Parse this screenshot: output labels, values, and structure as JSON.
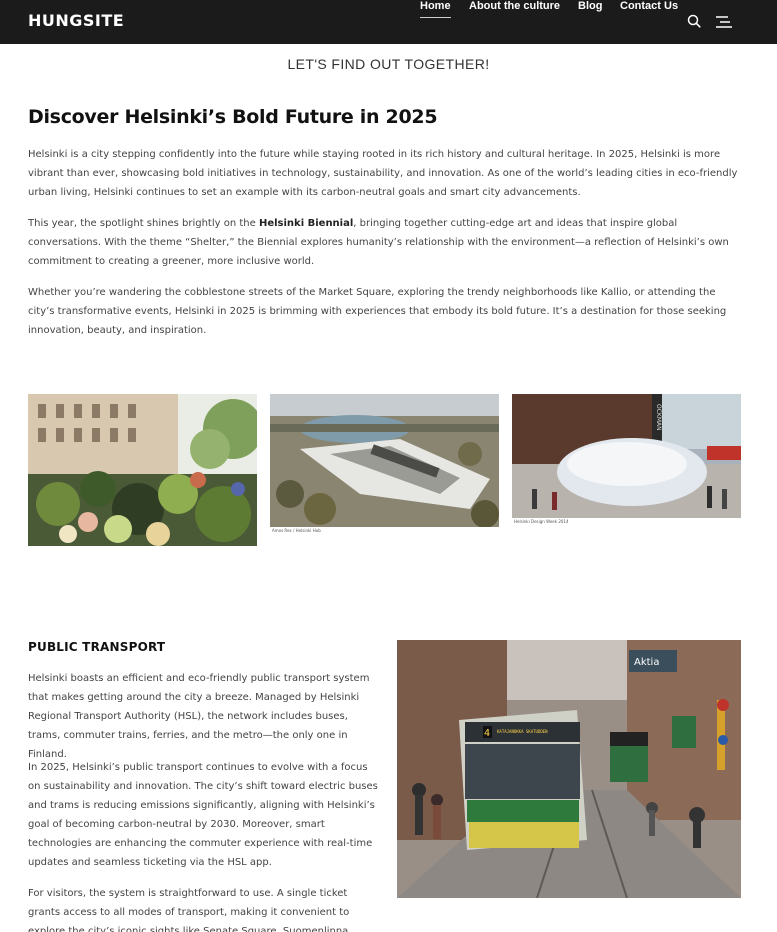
{
  "header": {
    "logo": "HUNGSITE",
    "nav": [
      {
        "label": "Home",
        "active": true
      },
      {
        "label": "About the culture",
        "active": false
      },
      {
        "label": "Blog",
        "active": false
      },
      {
        "label": "Contact Us",
        "active": false
      }
    ],
    "icons": [
      "search-icon",
      "menu-icon"
    ]
  },
  "tagline": "LET'S FIND OUT TOGETHER!",
  "article": {
    "title": "Discover Helsinki’s Bold Future in 2025",
    "p1": "Helsinki is a city stepping confidently into the future while staying rooted in its rich history and cultural heritage. In 2025, Helsinki is more vibrant than ever, showcasing bold initiatives in technology, sustainability, and innovation. As one of the world’s leading cities in eco-friendly urban living, Helsinki continues to set an example with its carbon-neutral goals and smart city advancements.",
    "p2_before": "This year, the spotlight shines brightly on the ",
    "p2_bold": "Helsinki Biennial",
    "p2_after": ", bringing together cutting-edge art and ideas that inspire global conversations. With the theme “Shelter,” the Biennial explores humanity’s relationship with the environment—a reflection of Helsinki’s own commitment to creating a greener, more inclusive world.",
    "p3": "Whether you’re wandering the cobblestone streets of the Market Square, exploring the trendy neighborhoods like Kallio, or attending the city’s transformative events, Helsinki in 2025 is brimming with experiences that embody its bold future. It’s a destination for those seeking innovation, beauty, and inspiration."
  },
  "gallery": {
    "captions": [
      "Amos Rex / Helsinki Hub",
      "Helsinki Design Week 2014"
    ]
  },
  "transport": {
    "heading": "PUBLIC TRANSPORT",
    "p1": "Helsinki boasts an efficient and eco-friendly public transport system that makes getting around the city a breeze. Managed by Helsinki Regional Transport Authority (HSL), the network includes buses, trams, commuter trains, ferries, and the metro—the only one in Finland.",
    "p2": "In 2025, Helsinki’s public transport continues to evolve with a focus on sustainability and innovation. The city’s shift toward electric buses and trams is reducing emissions significantly, aligning with Helsinki’s goal of becoming carbon-neutral by 2030. Moreover, smart technologies are enhancing the commuter experience with real-time updates and seamless ticketing via the HSL app.",
    "p3": "For visitors, the system is straightforward to use. A single ticket grants access to all modes of transport, making it convenient to explore the city’s iconic sights like Senate Square, Suomenlinna Fortress, and the",
    "image_signs": {
      "route": "4",
      "dest": "KATAJANOKKA SKATUDDEN",
      "store": "Aktia"
    }
  }
}
